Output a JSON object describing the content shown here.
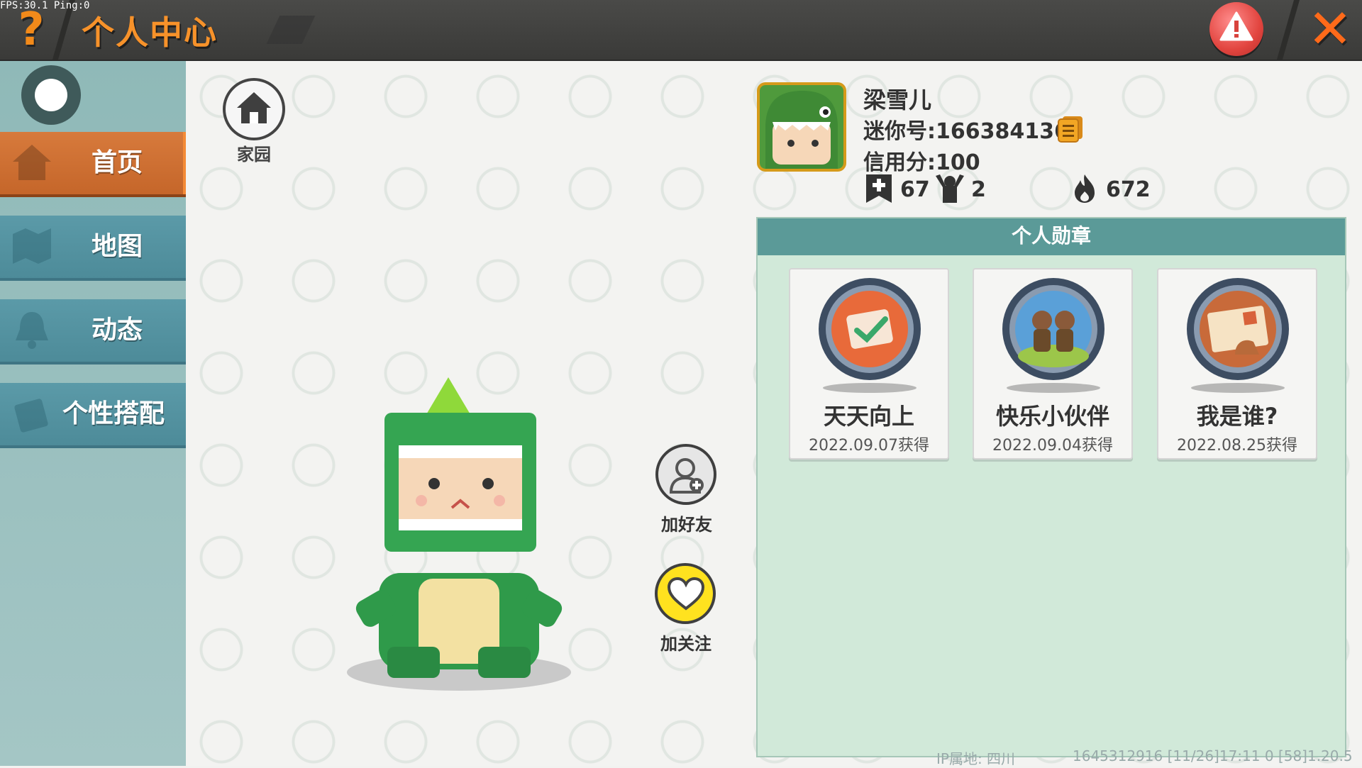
{
  "debug": {
    "fps_text": "FPS:30.1 Ping:0"
  },
  "header": {
    "title": "个人中心",
    "help_icon": "question-mark",
    "alert_icon": "warning-icon",
    "close_icon": "close-x"
  },
  "sidebar": {
    "items": [
      {
        "label": "首页",
        "icon": "home-house",
        "active": true
      },
      {
        "label": "地图",
        "icon": "map",
        "active": false
      },
      {
        "label": "动态",
        "icon": "bell",
        "active": false
      },
      {
        "label": "个性搭配",
        "icon": "character",
        "active": false
      }
    ]
  },
  "home": {
    "label": "家园"
  },
  "actions": {
    "add_friend_label": "加好友",
    "follow_label": "加关注"
  },
  "profile": {
    "name": "梁雪儿",
    "mini_id": "迷你号:1663841368",
    "credit": "信用分:100",
    "stats": [
      {
        "icon": "bookmark-plus",
        "value": "67"
      },
      {
        "icon": "fan-arms-up",
        "value": "2"
      },
      {
        "icon": "flame",
        "value": "672"
      }
    ]
  },
  "medals": {
    "title": "个人勋章",
    "items": [
      {
        "name": "天天向上",
        "date": "2022.09.07获得",
        "color": "#e86a3a"
      },
      {
        "name": "快乐小伙伴",
        "date": "2022.09.04获得",
        "color": "#5aa0d8"
      },
      {
        "name": "我是谁?",
        "date": "2022.08.25获得",
        "color": "#c86a3a"
      }
    ]
  },
  "footer": {
    "ip": "IP属地: 四川",
    "info": "1645312916   [11/26]17:11 0   [58]1.20.5"
  },
  "colors": {
    "accent": "#f7922a",
    "nav_bg": "#5b9aa8",
    "panel_header": "#5b9a98"
  }
}
